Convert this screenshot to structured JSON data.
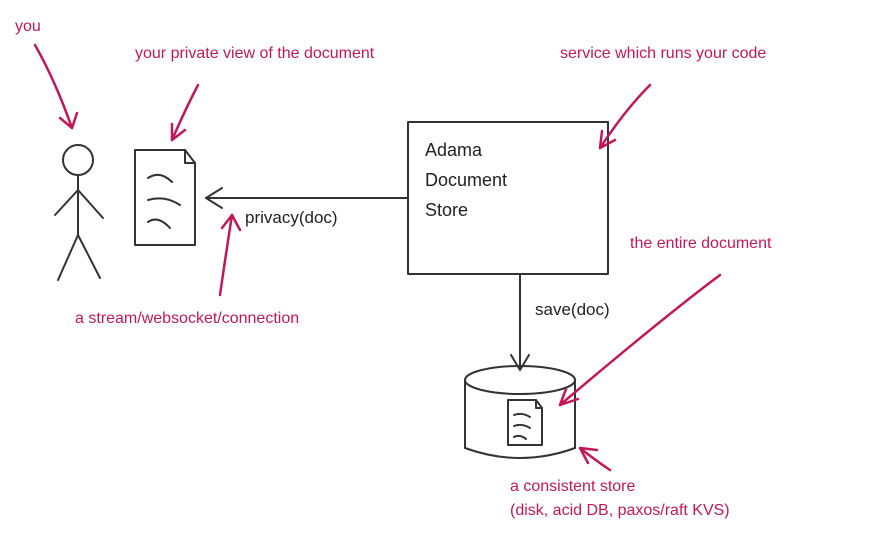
{
  "annotations": {
    "you": "you",
    "private_view": "your private view of the document",
    "service": "service which runs your code",
    "stream": "a stream/websocket/connection",
    "entire_doc": "the entire document",
    "consistent_store_line1": "a consistent store",
    "consistent_store_line2": "(disk, acid DB, paxos/raft KVS)"
  },
  "box": {
    "line1": "Adama",
    "line2": "Document",
    "line3": "Store"
  },
  "edges": {
    "privacy": "privacy(doc)",
    "save": "save(doc)"
  },
  "colors": {
    "annotation": "#c2185b",
    "stroke": "#333"
  }
}
